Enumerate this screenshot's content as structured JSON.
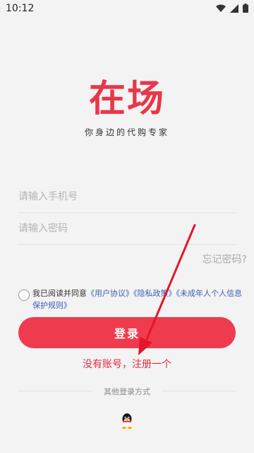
{
  "status_bar": {
    "time": "10:12"
  },
  "brand": {
    "logo": "在场",
    "slogan": "你身边的代购专家",
    "accent_color": "#ef3b4e"
  },
  "form": {
    "phone_placeholder": "请输入手机号",
    "password_placeholder": "请输入密码",
    "forgot_password": "忘记密码?"
  },
  "agreement": {
    "prefix": "我已阅读并同意",
    "user_agreement": "《用户协议》",
    "privacy_policy": "《隐私政策》",
    "minor_policy": "《未成年人个人信息保护规则》",
    "checked": false
  },
  "actions": {
    "login": "登录",
    "register": "没有账号，注册一个"
  },
  "other_login": {
    "label": "其他登录方式",
    "providers": [
      "qq-icon"
    ]
  }
}
